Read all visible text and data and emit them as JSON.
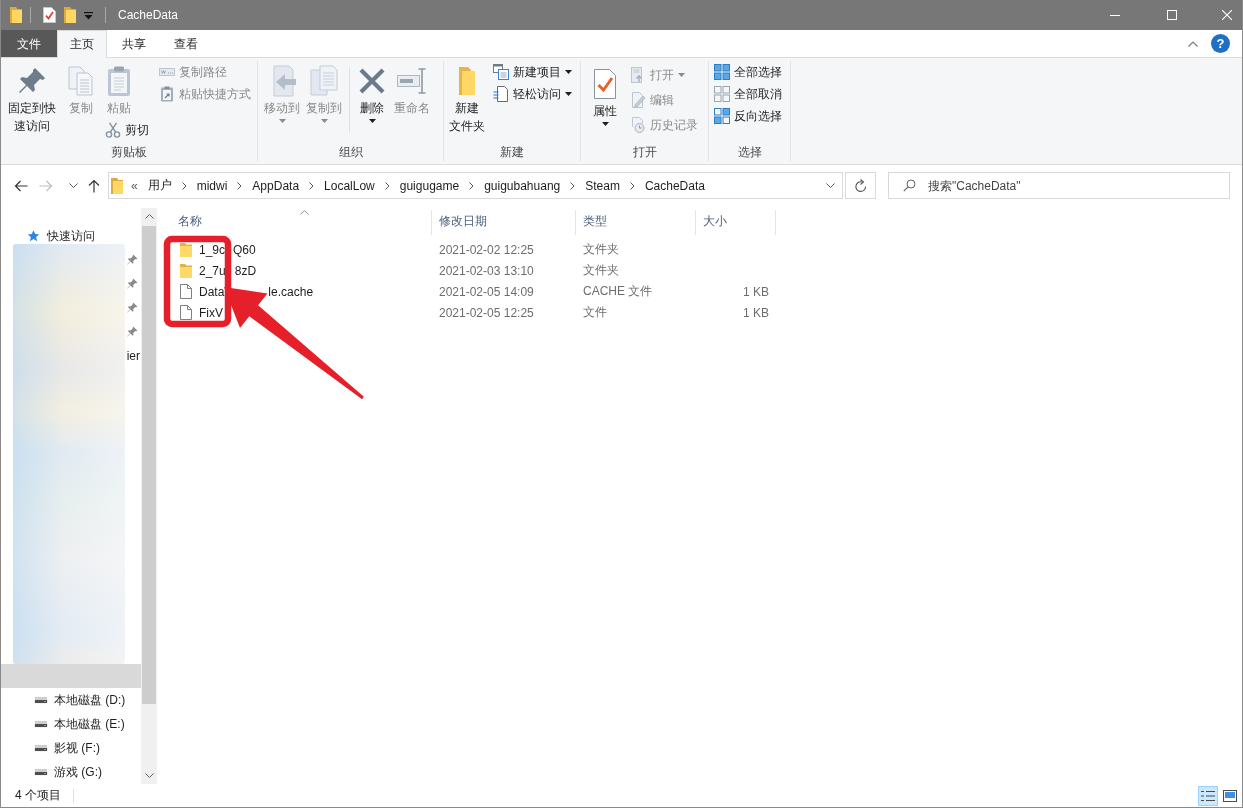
{
  "window": {
    "title": "CacheData"
  },
  "ribbon": {
    "tabs": [
      {
        "label": "文件",
        "kind": "file",
        "selected": false
      },
      {
        "label": "主页",
        "kind": "tab",
        "selected": true
      },
      {
        "label": "共享",
        "kind": "tab",
        "selected": false
      },
      {
        "label": "查看",
        "kind": "tab",
        "selected": false
      }
    ],
    "help": "?",
    "groups": [
      {
        "label": "剪贴板",
        "commands": [
          {
            "label": "固定到快速访问",
            "kind": "large",
            "disabled": false,
            "dropdown": false
          },
          {
            "label": "复制",
            "kind": "large",
            "disabled": true,
            "dropdown": false
          },
          {
            "label": "粘贴",
            "kind": "large",
            "disabled": true,
            "dropdown": false
          },
          {
            "label": "剪切",
            "kind": "small",
            "disabled": false,
            "dropdown": false
          },
          {
            "label": "复制路径",
            "kind": "small",
            "disabled": true,
            "dropdown": false
          },
          {
            "label": "粘贴快捷方式",
            "kind": "small",
            "disabled": true,
            "dropdown": false
          }
        ]
      },
      {
        "label": "组织",
        "commands": [
          {
            "label": "移动到",
            "kind": "large",
            "disabled": true,
            "dropdown": true
          },
          {
            "label": "复制到",
            "kind": "large",
            "disabled": true,
            "dropdown": true
          },
          {
            "label": "删除",
            "kind": "large",
            "disabled": false,
            "dropdown": true
          },
          {
            "label": "重命名",
            "kind": "large",
            "disabled": true,
            "dropdown": false
          }
        ]
      },
      {
        "label": "新建",
        "commands": [
          {
            "label": "新建文件夹",
            "kind": "large",
            "disabled": false,
            "dropdown": false
          },
          {
            "label": "新建项目",
            "kind": "small",
            "disabled": false,
            "dropdown": true
          },
          {
            "label": "轻松访问",
            "kind": "small",
            "disabled": false,
            "dropdown": true
          }
        ]
      },
      {
        "label": "打开",
        "commands": [
          {
            "label": "属性",
            "kind": "large",
            "disabled": false,
            "dropdown": true
          },
          {
            "label": "打开",
            "kind": "small",
            "disabled": true,
            "dropdown": true
          },
          {
            "label": "编辑",
            "kind": "small",
            "disabled": true,
            "dropdown": false
          },
          {
            "label": "历史记录",
            "kind": "small",
            "disabled": true,
            "dropdown": false
          }
        ]
      },
      {
        "label": "选择",
        "commands": [
          {
            "label": "全部选择",
            "kind": "small",
            "disabled": false,
            "dropdown": false
          },
          {
            "label": "全部取消",
            "kind": "small",
            "disabled": false,
            "dropdown": false
          },
          {
            "label": "反向选择",
            "kind": "small",
            "disabled": false,
            "dropdown": false
          }
        ]
      }
    ]
  },
  "address": {
    "back": {
      "disabled": false
    },
    "forward": {
      "disabled": true
    },
    "up": {
      "disabled": false
    },
    "overflow": "«",
    "path": [
      "用户",
      "midwi",
      "AppData",
      "LocalLow",
      "guigugame",
      "guigubahuang",
      "Steam",
      "CacheData"
    ],
    "search": {
      "placeholder": "搜索\"CacheData\""
    }
  },
  "navigation_pane": {
    "items": [
      {
        "kind": "quick_access",
        "label": "快速访问",
        "selected": false
      },
      {
        "kind": "pinned",
        "pinned": true
      },
      {
        "kind": "pinned",
        "pinned": true
      },
      {
        "kind": "pinned",
        "pinned": true
      },
      {
        "kind": "pinned",
        "pinned": true
      },
      {
        "kind": "fragment",
        "label": "ier"
      },
      {
        "kind": "obscured",
        "selected": true
      },
      {
        "kind": "drive",
        "label": "本地磁盘 (D:)",
        "selected": false
      },
      {
        "kind": "drive",
        "label": "本地磁盘 (E:)",
        "selected": false
      },
      {
        "kind": "drive",
        "label": "影视 (F:)",
        "selected": false
      },
      {
        "kind": "drive",
        "label": "游戏 (G:)",
        "selected": false
      }
    ]
  },
  "file_list": {
    "columns": [
      {
        "label": "名称",
        "sorted": true
      },
      {
        "label": "修改日期",
        "sorted": false
      },
      {
        "label": "类型",
        "sorted": false
      },
      {
        "label": "大小",
        "sorted": false
      }
    ],
    "rows": [
      {
        "kind": "folder",
        "name_parts": [
          "1_9c",
          "Q60"
        ],
        "date": "2021-02-02 12:25",
        "type": "文件夹",
        "selected": false
      },
      {
        "kind": "folder",
        "name_parts": [
          "2_7u",
          "8zD"
        ],
        "date": "2021-02-03 13:10",
        "type": "文件夹",
        "selected": false
      },
      {
        "kind": "file",
        "name_parts": [
          "Data",
          "le.cache"
        ],
        "date": "2021-02-05 14:09",
        "type": "CACHE 文件",
        "size": "1 KB",
        "selected": false
      },
      {
        "kind": "file",
        "name_parts": [
          "FixV"
        ],
        "date": "2021-02-05 12:25",
        "type": "文件",
        "size": "1 KB",
        "selected": false
      }
    ]
  },
  "status_bar": {
    "item_count": "4 个项目",
    "views": [
      {
        "selected": true
      },
      {
        "selected": false
      }
    ]
  }
}
